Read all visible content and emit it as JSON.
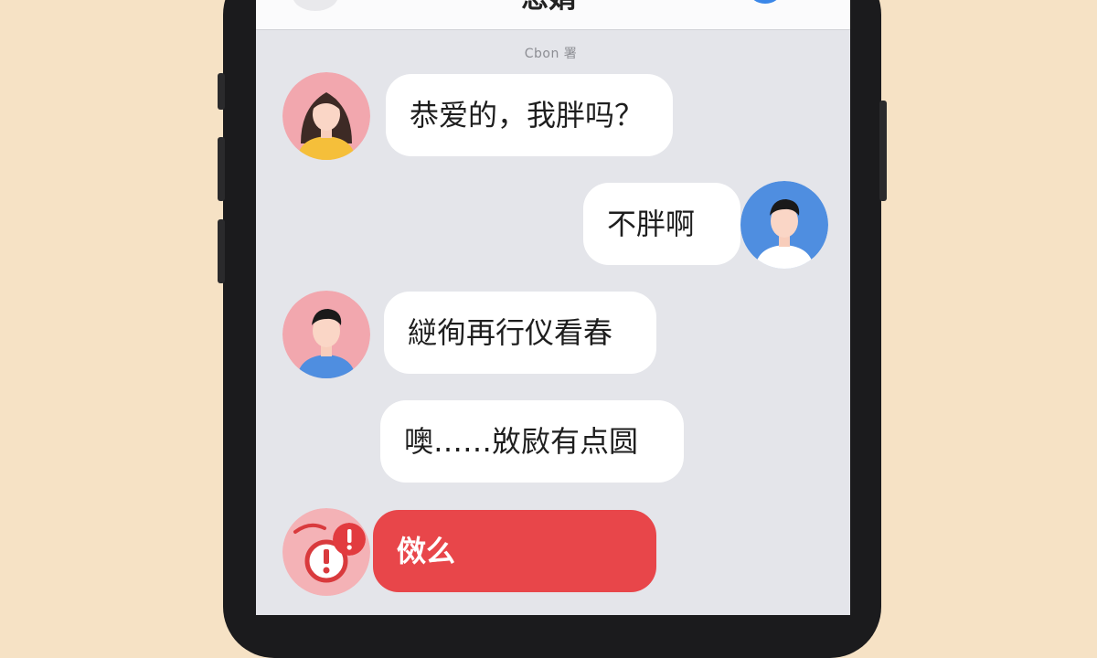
{
  "header": {
    "title": "恩娟"
  },
  "timestamp": "Cbon 署",
  "colors": {
    "background": "#f6e2c5",
    "screen": "#e4e5ea",
    "bubble": "#ffffff",
    "warning": "#e8464a",
    "accent": "#3b87e8"
  },
  "messages": [
    {
      "side": "left",
      "avatar": "girlfriend-avatar",
      "text": "恭爱的，我胖吗？"
    },
    {
      "side": "right",
      "avatar": "boyfriend-avatar",
      "text": "不胖啊"
    },
    {
      "side": "left",
      "avatar": "man-avatar",
      "text": "縌徇再行仪看春"
    },
    {
      "side": "left",
      "avatar": null,
      "text": "噢……敚敐有点圆"
    },
    {
      "side": "left",
      "avatar": "warning-avatar",
      "text": "傚么"
    }
  ]
}
